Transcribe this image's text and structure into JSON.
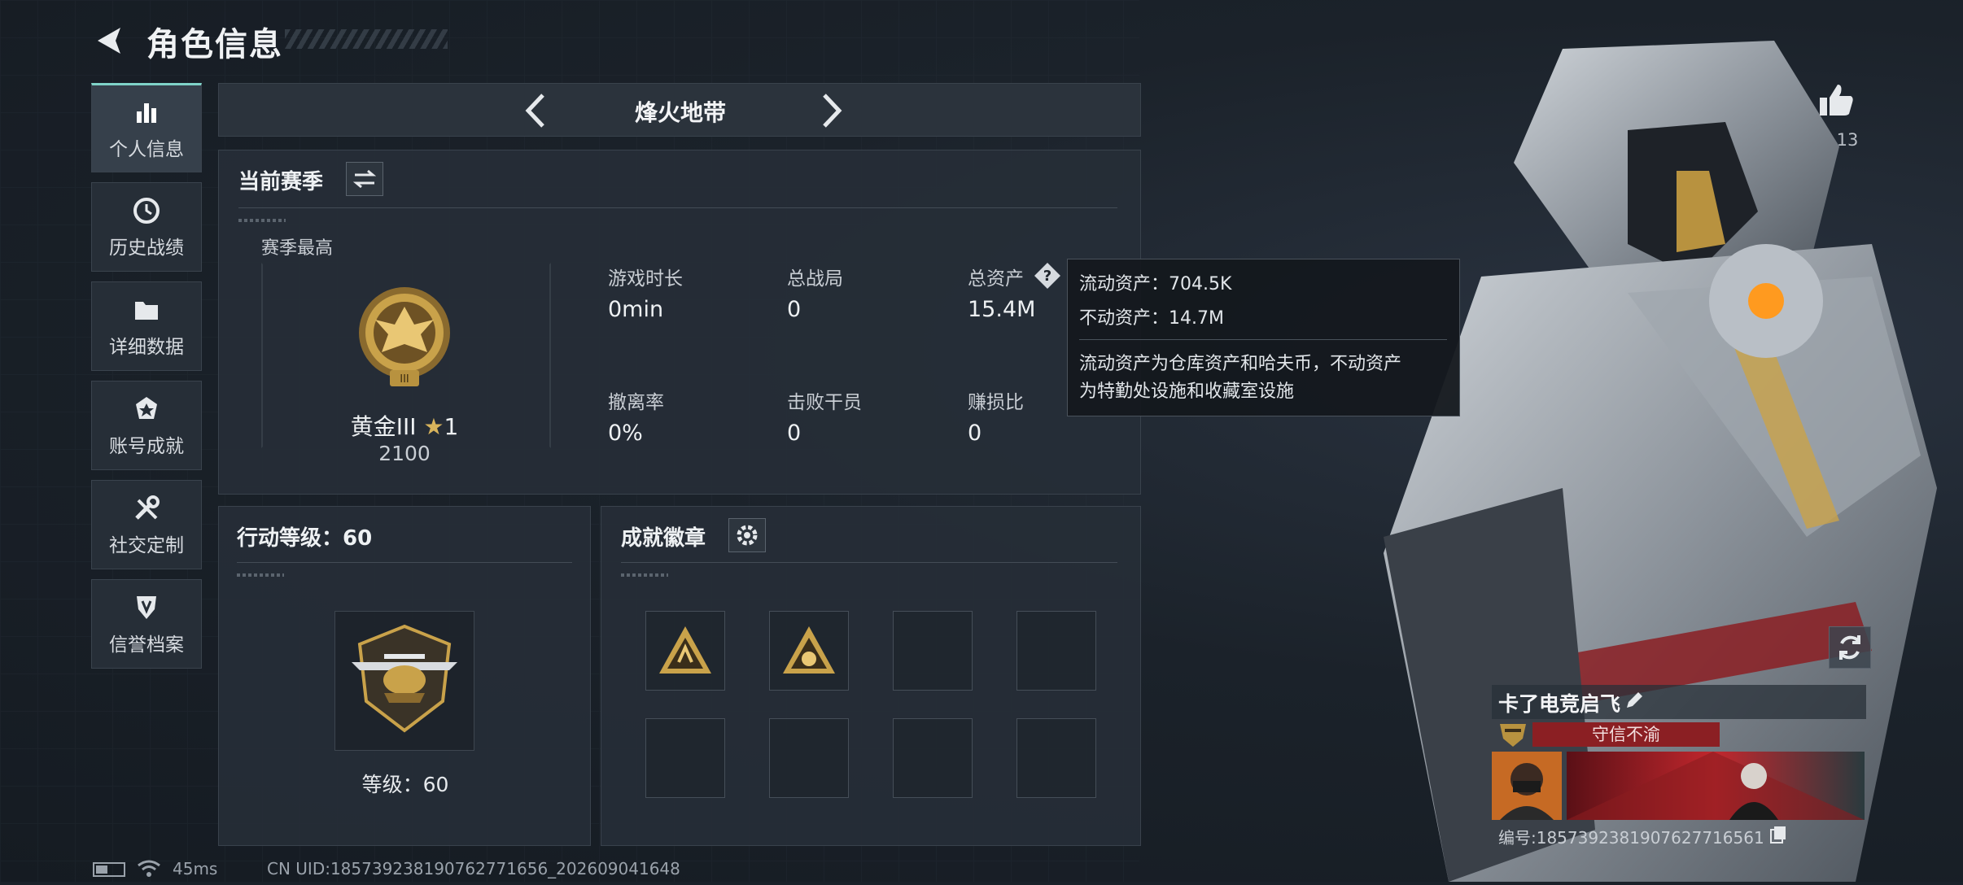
{
  "header": {
    "title": "角色信息"
  },
  "sidebar": {
    "items": [
      {
        "label": "个人信息",
        "icon": "bar-chart-icon",
        "active": true
      },
      {
        "label": "历史战绩",
        "icon": "clock-icon"
      },
      {
        "label": "详细数据",
        "icon": "folder-icon"
      },
      {
        "label": "账号成就",
        "icon": "medal-icon"
      },
      {
        "label": "社交定制",
        "icon": "tools-icon"
      },
      {
        "label": "信誉档案",
        "icon": "shield-icon"
      }
    ]
  },
  "mode": {
    "name": "烽火地带"
  },
  "season": {
    "title": "当前赛季",
    "highest_label": "赛季最高",
    "rank_name": "黄金III",
    "rank_stars": "1",
    "rank_points": "2100",
    "stats": [
      {
        "label": "游戏时长",
        "value": "0min"
      },
      {
        "label": "总战局",
        "value": "0"
      },
      {
        "label": "总资产",
        "value": "15.4M"
      },
      {
        "label": "撤离率",
        "value": "0%"
      },
      {
        "label": "击败干员",
        "value": "0"
      },
      {
        "label": "赚损比",
        "value": "0"
      }
    ]
  },
  "tooltip": {
    "liquid": "流动资产：704.5K",
    "fixed": "不动资产：14.7M",
    "desc_line1": "流动资产为仓库资产和哈夫币，不动资产",
    "desc_line2": "为特勤处设施和收藏室设施"
  },
  "action_level": {
    "title": "行动等级：60",
    "level_label": "等级：60"
  },
  "badges": {
    "title": "成就徽章",
    "slots_filled": 2,
    "slots_total": 8
  },
  "player": {
    "likes": "13",
    "name": "卡了电竞启飞",
    "reputation": "守信不渝",
    "id_line": "编号:1857392381907627716561"
  },
  "status_bar": {
    "ping": "45ms",
    "uid": "CN UID:1857392381907627716​56_202609041648"
  },
  "colors": {
    "accent": "#7fd3c8",
    "gold": "#c9a24a",
    "reputation_bg": "#8b1f23"
  }
}
